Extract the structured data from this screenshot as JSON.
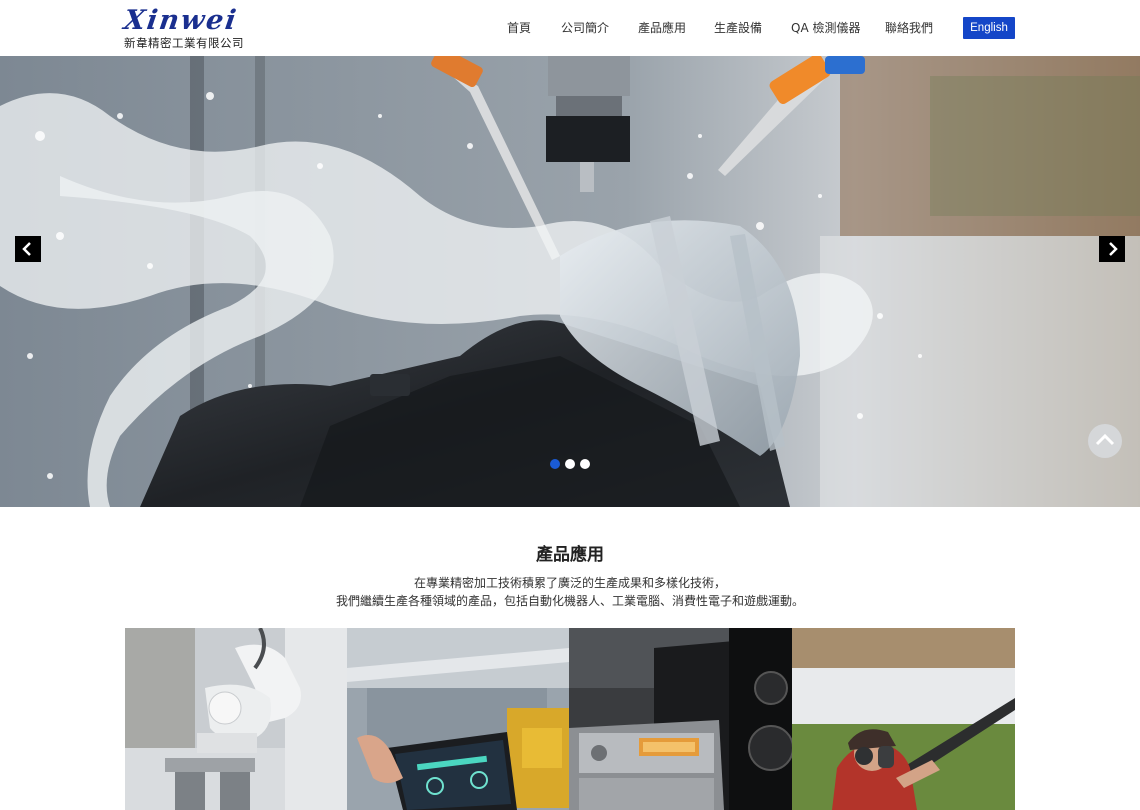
{
  "header": {
    "logo_text": "Xinwei",
    "company_name": "新韋精密工業有限公司",
    "nav": [
      {
        "label": "首頁"
      },
      {
        "label": "公司簡介"
      },
      {
        "label": "產品應用"
      },
      {
        "label": "生產設備"
      },
      {
        "label": "QA 檢測儀器"
      },
      {
        "label": "聯絡我們"
      }
    ],
    "lang_button": "English"
  },
  "hero": {
    "prev_icon": "chevron-left-icon",
    "next_icon": "chevron-right-icon",
    "slides_count": 3,
    "active_slide": 1
  },
  "scroll_top_icon": "chevron-up-icon",
  "section": {
    "title": "產品應用",
    "desc_line1": "在專業精密加工技術積累了廣泛的生產成果和多樣化技術，",
    "desc_line2": "我們繼續生產各種領域的產品，包括自動化機器人、工業電腦、消費性電子和遊戲運動。"
  },
  "colors": {
    "brand": "#1a2f8f",
    "accent": "#1446c8",
    "dot_active": "#1a5bd6"
  }
}
